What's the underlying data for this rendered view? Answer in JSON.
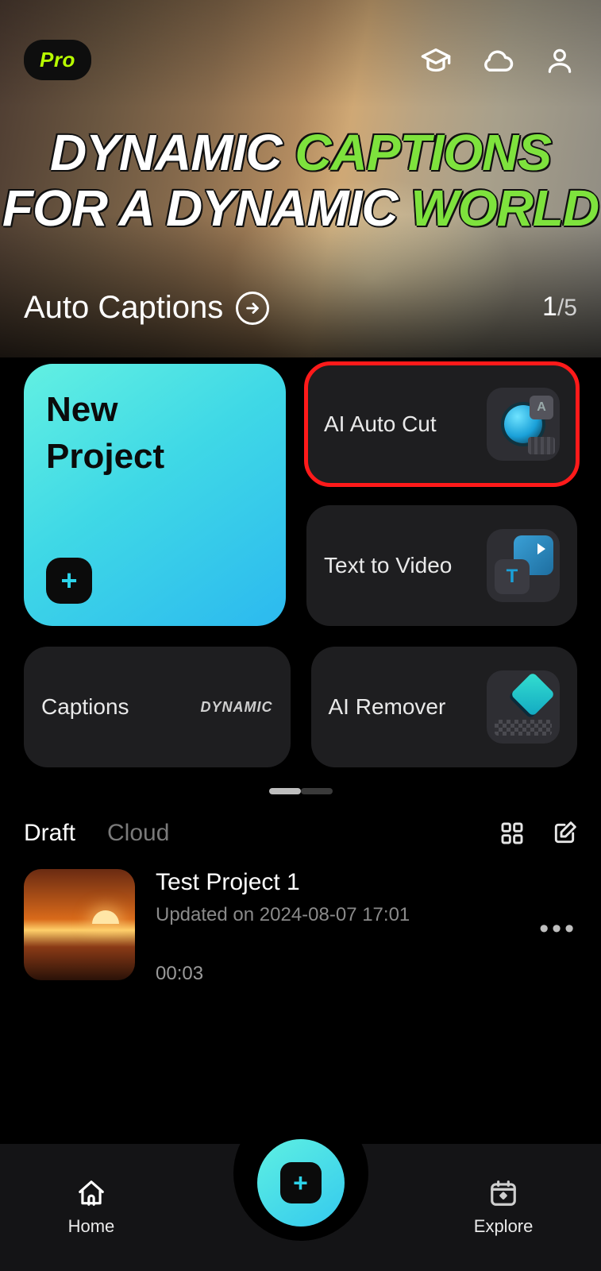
{
  "badge": {
    "pro": "Pro"
  },
  "hero": {
    "line1_a": "DYNAMIC ",
    "line1_b": "CAPTIONS",
    "line2_a": "FOR  A DYNAMIC ",
    "line2_b": "WORLD",
    "feature": "Auto Captions",
    "pager_current": "1",
    "pager_total": "/5"
  },
  "tools": {
    "new_project": "New\nProject",
    "ai_auto_cut": "AI Auto Cut",
    "text_to_video": "Text to Video",
    "captions": "Captions",
    "captions_thumb": "DYNAMIC",
    "ai_remover": "AI Remover"
  },
  "tabs": {
    "draft": "Draft",
    "cloud": "Cloud"
  },
  "project": {
    "title": "Test Project 1",
    "updated": "Updated on 2024-08-07 17:01",
    "duration": "00:03"
  },
  "nav": {
    "home": "Home",
    "explore": "Explore"
  }
}
